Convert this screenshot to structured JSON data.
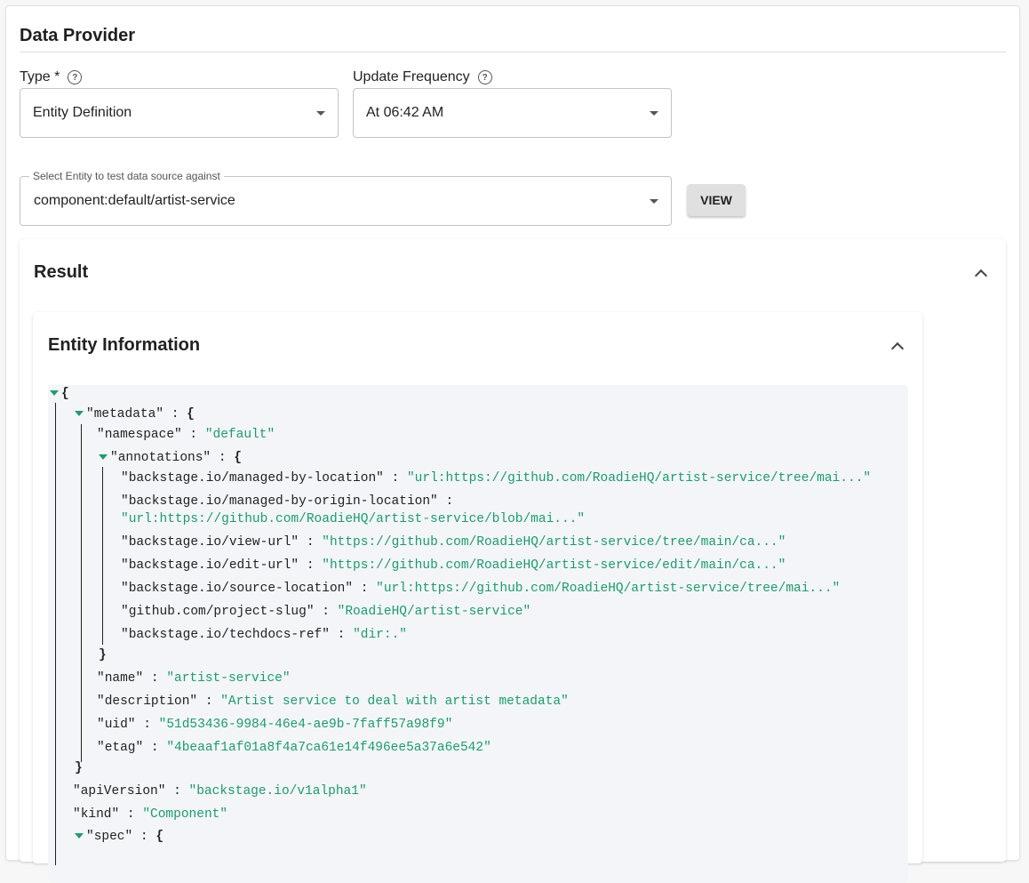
{
  "section_title": "Data Provider",
  "type_field": {
    "label": "Type *",
    "value": "Entity Definition"
  },
  "frequency_field": {
    "label": "Update Frequency",
    "value": "At 06:42 AM"
  },
  "entity_field": {
    "legend": "Select Entity to test data source against",
    "value": "component:default/artist-service"
  },
  "view_button": "VIEW",
  "result_title": "Result",
  "entity_info_title": "Entity Information",
  "json_view": {
    "open_brace": "{",
    "metadata_key": "\"metadata\"",
    "namespace_key": "\"namespace\"",
    "namespace_val": "\"default\"",
    "annotations_key": "\"annotations\"",
    "annotations": [
      {
        "key": "\"backstage.io/managed-by-location\"",
        "val": "\"url:https://github.com/RoadieHQ/artist-service/tree/mai...\""
      },
      {
        "key": "\"backstage.io/managed-by-origin-location\"",
        "val": "\"url:https://github.com/RoadieHQ/artist-service/blob/mai...\""
      },
      {
        "key": "\"backstage.io/view-url\"",
        "val": "\"https://github.com/RoadieHQ/artist-service/tree/main/ca...\""
      },
      {
        "key": "\"backstage.io/edit-url\"",
        "val": "\"https://github.com/RoadieHQ/artist-service/edit/main/ca...\""
      },
      {
        "key": "\"backstage.io/source-location\"",
        "val": "\"url:https://github.com/RoadieHQ/artist-service/tree/mai...\""
      },
      {
        "key": "\"github.com/project-slug\"",
        "val": "\"RoadieHQ/artist-service\""
      },
      {
        "key": "\"backstage.io/techdocs-ref\"",
        "val": "\"dir:.\""
      }
    ],
    "name_key": "\"name\"",
    "name_val": "\"artist-service\"",
    "description_key": "\"description\"",
    "description_val": "\"Artist service to deal with artist metadata\"",
    "uid_key": "\"uid\"",
    "uid_val": "\"51d53436-9984-46e4-ae9b-7faff57a98f9\"",
    "etag_key": "\"etag\"",
    "etag_val": "\"4beaaf1af01a8f4a7ca61e14f496ee5a37a6e542\"",
    "apiVersion_key": "\"apiVersion\"",
    "apiVersion_val": "\"backstage.io/v1alpha1\"",
    "kind_key": "\"kind\"",
    "kind_val": "\"Component\"",
    "spec_key": "\"spec\""
  },
  "colors": {
    "string": "#1a9d6c",
    "button": "#e0e0e0"
  }
}
